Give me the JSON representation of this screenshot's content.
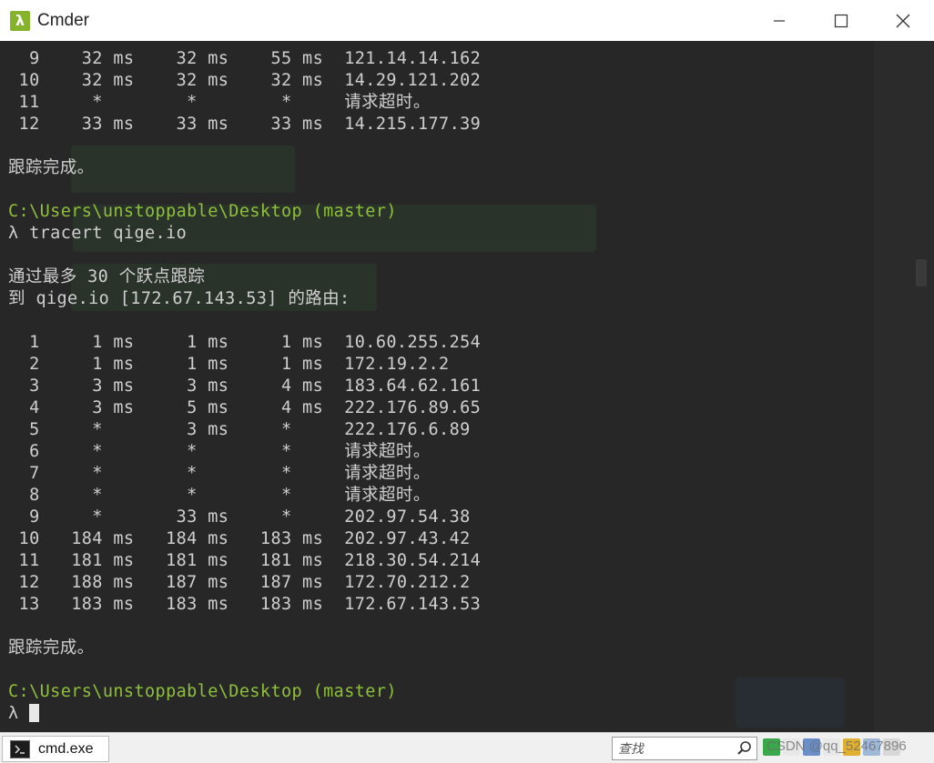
{
  "window": {
    "title": "Cmder",
    "app_icon_glyph": "λ",
    "controls": [
      "minimize-icon",
      "maximize-icon",
      "close-icon"
    ]
  },
  "terminal": {
    "lines": [
      {
        "text": "  9    32 ms    32 ms    55 ms  121.14.14.162",
        "kind": "normal"
      },
      {
        "text": " 10    32 ms    32 ms    32 ms  14.29.121.202",
        "kind": "normal"
      },
      {
        "text": " 11     *        *        *     请求超时。",
        "kind": "normal"
      },
      {
        "text": " 12    33 ms    33 ms    33 ms  14.215.177.39",
        "kind": "normal"
      },
      {
        "text": "",
        "kind": "normal"
      },
      {
        "text": "跟踪完成。",
        "kind": "normal"
      },
      {
        "text": "",
        "kind": "normal"
      },
      {
        "text": "C:\\Users\\unstoppable\\Desktop (master)",
        "kind": "path"
      },
      {
        "text": "λ tracert qige.io",
        "kind": "normal"
      },
      {
        "text": "",
        "kind": "normal"
      },
      {
        "text": "通过最多 30 个跃点跟踪",
        "kind": "normal"
      },
      {
        "text": "到 qige.io [172.67.143.53] 的路由:",
        "kind": "normal"
      },
      {
        "text": "",
        "kind": "normal"
      },
      {
        "text": "  1     1 ms     1 ms     1 ms  10.60.255.254",
        "kind": "normal"
      },
      {
        "text": "  2     1 ms     1 ms     1 ms  172.19.2.2",
        "kind": "normal"
      },
      {
        "text": "  3     3 ms     3 ms     4 ms  183.64.62.161",
        "kind": "normal"
      },
      {
        "text": "  4     3 ms     5 ms     4 ms  222.176.89.65",
        "kind": "normal"
      },
      {
        "text": "  5     *        3 ms     *     222.176.6.89",
        "kind": "normal"
      },
      {
        "text": "  6     *        *        *     请求超时。",
        "kind": "normal"
      },
      {
        "text": "  7     *        *        *     请求超时。",
        "kind": "normal"
      },
      {
        "text": "  8     *        *        *     请求超时。",
        "kind": "normal"
      },
      {
        "text": "  9     *       33 ms     *     202.97.54.38",
        "kind": "normal"
      },
      {
        "text": " 10   184 ms   184 ms   183 ms  202.97.43.42",
        "kind": "normal"
      },
      {
        "text": " 11   181 ms   181 ms   181 ms  218.30.54.214",
        "kind": "normal"
      },
      {
        "text": " 12   188 ms   187 ms   187 ms  172.70.212.2",
        "kind": "normal"
      },
      {
        "text": " 13   183 ms   183 ms   183 ms  172.67.143.53",
        "kind": "normal"
      },
      {
        "text": "",
        "kind": "normal"
      },
      {
        "text": "跟踪完成。",
        "kind": "normal"
      },
      {
        "text": "",
        "kind": "normal"
      },
      {
        "text": "C:\\Users\\unstoppable\\Desktop (master)",
        "kind": "path"
      },
      {
        "text": "λ ",
        "kind": "prompt"
      }
    ]
  },
  "statusbar": {
    "tab_label": "cmd.exe",
    "search_placeholder": "查找",
    "watermark": "CSDN @qq_52467896"
  },
  "colors": {
    "terminal_bg": "#272727",
    "text": "#cfcfcf",
    "path": "#8fc03b",
    "app_icon": "#86b32c"
  }
}
